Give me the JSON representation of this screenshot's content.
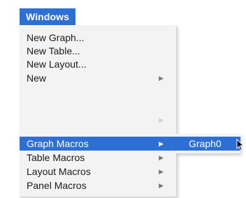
{
  "menubar": {
    "title": "Windows"
  },
  "menu": {
    "items": [
      {
        "label": "New Graph...",
        "state": "normal",
        "has_submenu": false
      },
      {
        "label": "New Table...",
        "state": "normal",
        "has_submenu": false
      },
      {
        "label": "New Layout...",
        "state": "normal",
        "has_submenu": false
      },
      {
        "label": "New",
        "state": "normal",
        "has_submenu": true
      },
      {
        "label": "",
        "state": "disabled",
        "has_submenu": true
      },
      {
        "label": "Graph Macros",
        "state": "highlighted",
        "has_submenu": true
      },
      {
        "label": "Table Macros",
        "state": "normal",
        "has_submenu": true
      },
      {
        "label": "Layout Macros",
        "state": "normal",
        "has_submenu": true
      },
      {
        "label": "Panel Macros",
        "state": "normal",
        "has_submenu": true
      }
    ],
    "submenu_arrow_icon": "triangle-right-icon"
  },
  "submenu": {
    "items": [
      {
        "label": "Graph0",
        "state": "highlighted"
      }
    ]
  },
  "colors": {
    "highlight": "#2e6fd4",
    "menu_background": "#f3f3f3",
    "text": "#1a1a1a",
    "disabled_text": "#c4c4c4"
  },
  "cursor_icon": "pointer-arrow-icon"
}
